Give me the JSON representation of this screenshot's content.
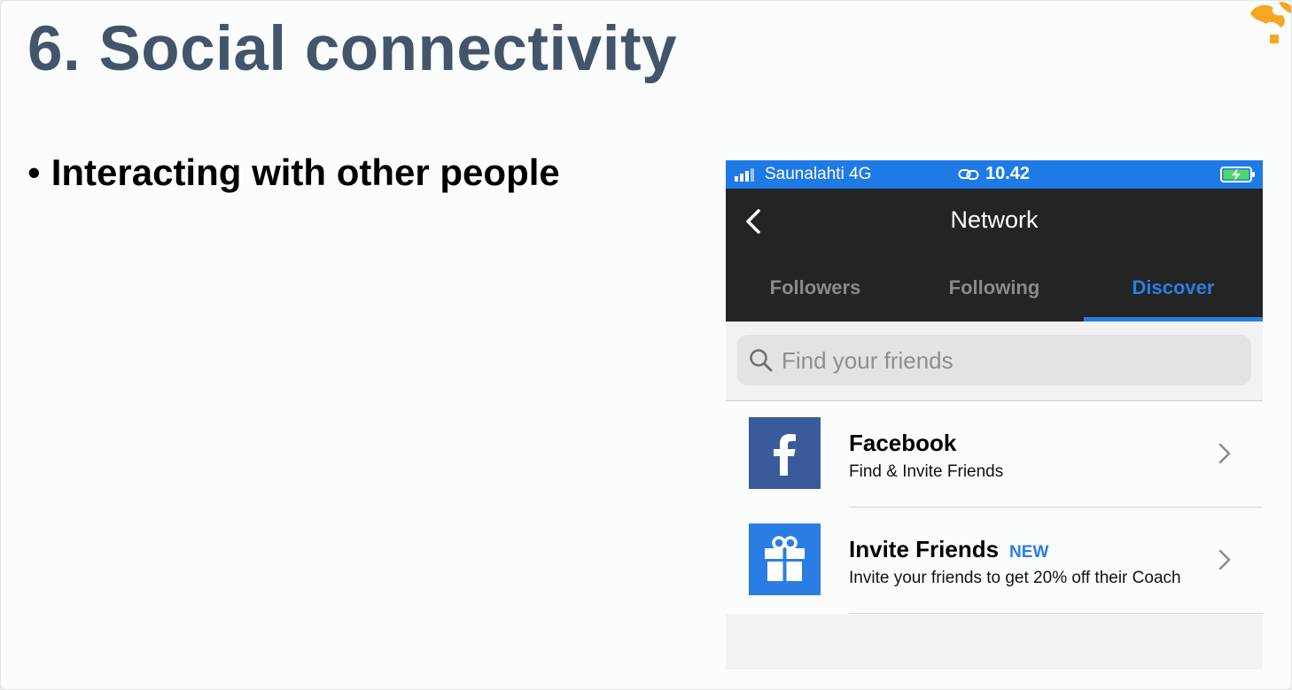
{
  "slide": {
    "title": "6. Social connectivity",
    "bullet": "Interacting with other people",
    "accent_color": "#43546b",
    "logo_color": "#f5a623"
  },
  "phone": {
    "status": {
      "carrier": "Saunalahti  4G",
      "time": "10.42"
    },
    "nav": {
      "title": "Network"
    },
    "tabs": [
      {
        "label": "Followers",
        "active": false
      },
      {
        "label": "Following",
        "active": false
      },
      {
        "label": "Discover",
        "active": true
      }
    ],
    "search": {
      "placeholder": "Find your friends"
    },
    "rows": [
      {
        "title": "Facebook",
        "subtitle": "Find & Invite Friends",
        "icon": "facebook-icon",
        "badge": ""
      },
      {
        "title": "Invite Friends",
        "subtitle": "Invite your friends to get 20% off their Coach",
        "icon": "gift-icon",
        "badge": "NEW"
      }
    ],
    "colors": {
      "status_bar": "#1f7ae6",
      "nav_bar": "#232423",
      "active_tab": "#2b7de4",
      "facebook_tile": "#3b5a9a",
      "gift_tile": "#2b7de4"
    }
  }
}
